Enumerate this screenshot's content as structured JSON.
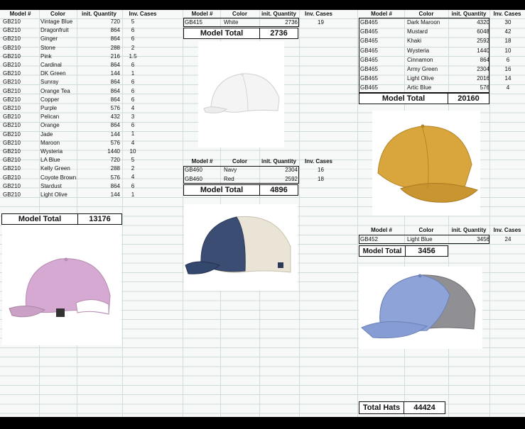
{
  "headers": {
    "model": "Model #",
    "color": "Color",
    "qty": "init. Quantity",
    "cases": "Inv. Cases"
  },
  "total_label": "Model Total",
  "table_gb210": {
    "rows": [
      {
        "model": "GB210",
        "color": "Vintage Blue",
        "qty": "720",
        "cases": "5"
      },
      {
        "model": "GB210",
        "color": "Dragonfruit",
        "qty": "864",
        "cases": "6"
      },
      {
        "model": "GB210",
        "color": "Ginger",
        "qty": "864",
        "cases": "6"
      },
      {
        "model": "GB210",
        "color": "Stone",
        "qty": "288",
        "cases": "2"
      },
      {
        "model": "GB210",
        "color": "Pink",
        "qty": "216",
        "cases": "1.5"
      },
      {
        "model": "GB210",
        "color": "Cardinal",
        "qty": "864",
        "cases": "6"
      },
      {
        "model": "GB210",
        "color": "DK Green",
        "qty": "144",
        "cases": "1"
      },
      {
        "model": "GB210",
        "color": "Sunray",
        "qty": "864",
        "cases": "6"
      },
      {
        "model": "GB210",
        "color": "Orange Tea",
        "qty": "864",
        "cases": "6"
      },
      {
        "model": "GB210",
        "color": "Copper",
        "qty": "864",
        "cases": "6"
      },
      {
        "model": "GB210",
        "color": "Purple",
        "qty": "576",
        "cases": "4"
      },
      {
        "model": "GB210",
        "color": "Pelican",
        "qty": "432",
        "cases": "3"
      },
      {
        "model": "GB210",
        "color": "Orange",
        "qty": "864",
        "cases": "6"
      },
      {
        "model": "GB210",
        "color": "Jade",
        "qty": "144",
        "cases": "1"
      },
      {
        "model": "GB210",
        "color": "Maroon",
        "qty": "576",
        "cases": "4"
      },
      {
        "model": "GB210",
        "color": "Wysteria",
        "qty": "1440",
        "cases": "10"
      },
      {
        "model": "GB210",
        "color": "LA Blue",
        "qty": "720",
        "cases": "5"
      },
      {
        "model": "GB210",
        "color": "Kelly Green",
        "qty": "288",
        "cases": "2"
      },
      {
        "model": "GB210",
        "color": "Coyote Brown",
        "qty": "576",
        "cases": "4"
      },
      {
        "model": "GB210",
        "color": "Stardust",
        "qty": "864",
        "cases": "6"
      },
      {
        "model": "GB210",
        "color": "Light Olive",
        "qty": "144",
        "cases": "1"
      }
    ],
    "total": "13176"
  },
  "table_gb415": {
    "rows": [
      {
        "model": "GB415",
        "color": "White",
        "qty": "2736",
        "cases": "19"
      }
    ],
    "total": "2736"
  },
  "table_gb460": {
    "rows": [
      {
        "model": "GB460",
        "color": "Navy",
        "qty": "2304",
        "cases": "16"
      },
      {
        "model": "GB460",
        "color": "Red",
        "qty": "2592",
        "cases": "18"
      }
    ],
    "total": "4896"
  },
  "table_gb465": {
    "rows": [
      {
        "model": "GB465",
        "color": "Dark Maroon",
        "qty": "4320",
        "cases": "30"
      },
      {
        "model": "GB465",
        "color": "Mustard",
        "qty": "6048",
        "cases": "42"
      },
      {
        "model": "GB465",
        "color": "Khaki",
        "qty": "2592",
        "cases": "18"
      },
      {
        "model": "GB465",
        "color": "Wysteria",
        "qty": "1440",
        "cases": "10"
      },
      {
        "model": "GB465",
        "color": "Cinnamon",
        "qty": "864",
        "cases": "6"
      },
      {
        "model": "GB465",
        "color": "Army Green",
        "qty": "2304",
        "cases": "16"
      },
      {
        "model": "GB465",
        "color": "Light Olive",
        "qty": "2016",
        "cases": "14"
      },
      {
        "model": "GB465",
        "color": "Artic Blue",
        "qty": "576",
        "cases": "4"
      }
    ],
    "total": "20160"
  },
  "table_gb452": {
    "rows": [
      {
        "model": "GB452",
        "color": "Light Blue",
        "qty": "3456",
        "cases": "24"
      }
    ],
    "total": "3456"
  },
  "grand_total": {
    "label": "Total Hats",
    "value": "44424"
  },
  "photos": {
    "pink_cap": "pink-cap-photo",
    "white_cap": "white-cap-photo",
    "navy_trucker_cap": "navy-trucker-cap-photo",
    "mustard_cap": "mustard-cap-photo",
    "blue_trucker_cap": "light-blue-trucker-cap-photo"
  },
  "colors": {
    "grid": "#cfdcd6",
    "sheet_bg": "#f7f9f8",
    "frame": "#000000"
  }
}
